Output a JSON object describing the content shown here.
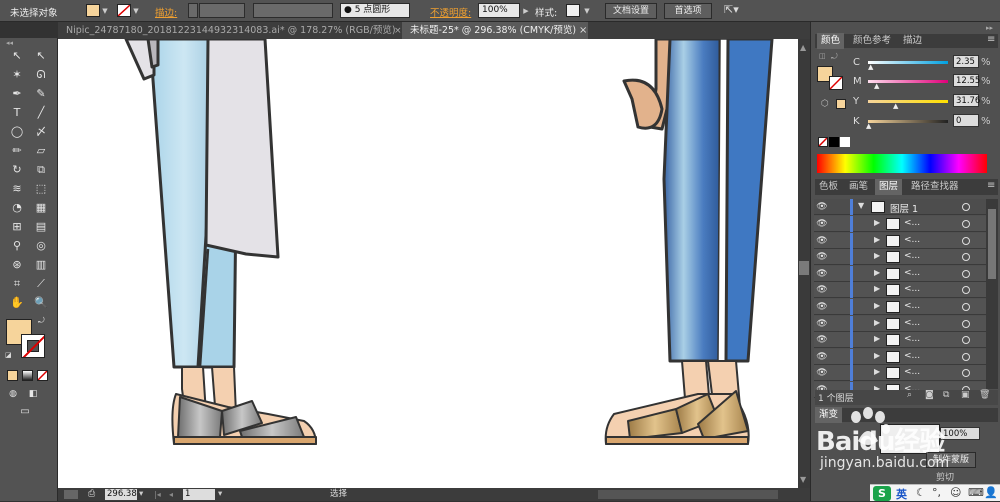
{
  "control_bar": {
    "selection_label": "未选择对象",
    "stroke_label": "描边:",
    "brush_size": "5 点圆形",
    "opacity_label": "不透明度:",
    "opacity_value": "100%",
    "style_label": "样式:",
    "doc_setup_button": "文档设置",
    "preferences_button": "首选项",
    "fill_color": "#f6d49b",
    "label_accent": "#f0a030"
  },
  "tabs": [
    {
      "label": "Nipic_24787180_20181223144932314083.ai* @ 178.27% (RGB/预览)",
      "active": false
    },
    {
      "label": "未标题-25* @ 296.38% (CMYK/预览)",
      "active": true
    }
  ],
  "status_bar": {
    "zoom": "296.38",
    "page": "1",
    "mode": "选择"
  },
  "color_panel": {
    "tabs": [
      "颜色",
      "颜色参考",
      "描边"
    ],
    "channels": [
      {
        "name": "C",
        "value": "2.35"
      },
      {
        "name": "M",
        "value": "12.55"
      },
      {
        "name": "Y",
        "value": "31.76"
      },
      {
        "name": "K",
        "value": "0"
      }
    ],
    "fill_color": "#f6d49b"
  },
  "layers_panel": {
    "tabs": [
      "色板",
      "画笔",
      "图层",
      "路径查找器"
    ],
    "layer_name": "图层 1",
    "sublayer_label": "<...",
    "sublayer_count": 11,
    "footer_label": "1 个图层"
  },
  "transparency_panel": {
    "tab_label": "渐变",
    "opacity_value": "100%",
    "mask_button": "制作蒙版",
    "clip_label": "剪切"
  },
  "watermark": {
    "brand": "Baidu经验",
    "url": "jingyan.baidu.com"
  },
  "taskbar": {
    "ime_label": "英"
  }
}
